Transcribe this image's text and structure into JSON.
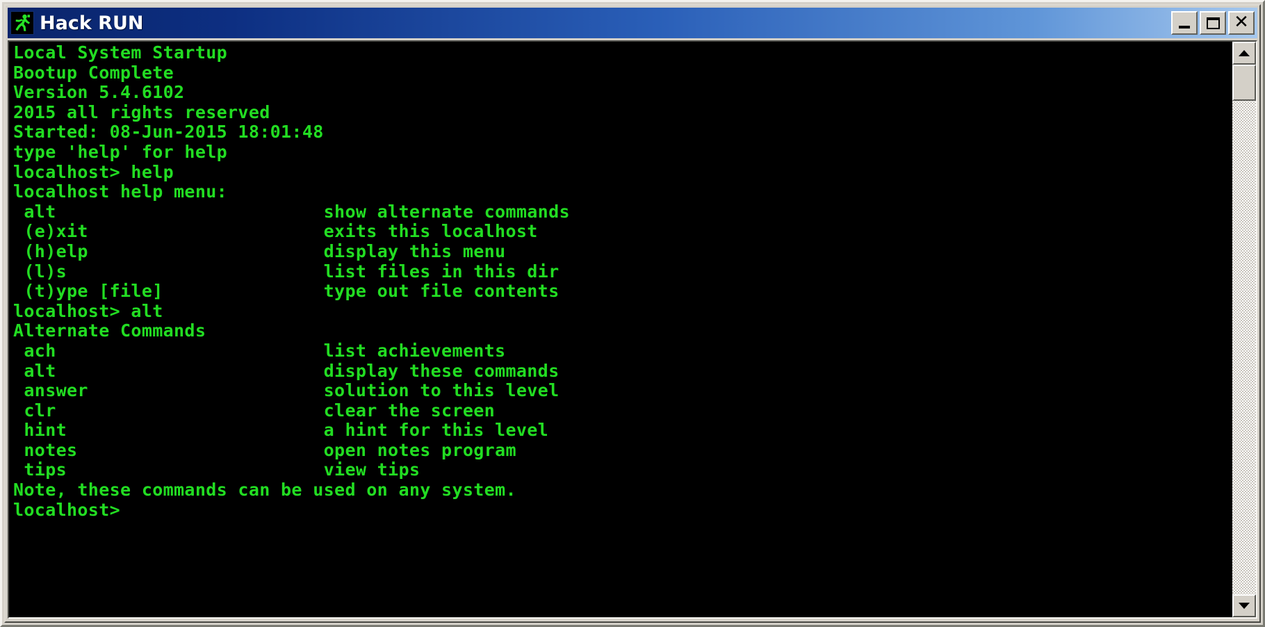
{
  "window": {
    "title": "Hack RUN",
    "icon": "running-man-icon",
    "buttons": {
      "minimize": "_",
      "maximize": "□",
      "close": "✕"
    },
    "accent_title_start": "#0a246a",
    "accent_title_end": "#a6c8ee",
    "chrome_color": "#d4d0c8"
  },
  "terminal": {
    "foreground": "#22dd22",
    "background": "#000000",
    "lines": [
      "Local System Startup",
      "Bootup Complete",
      "Version 5.4.6102",
      "2015 all rights reserved",
      "Started: 08-Jun-2015 18:01:48",
      "type 'help' for help",
      "localhost> help",
      "localhost help menu:",
      " alt                         show alternate commands",
      " (e)xit                      exits this localhost",
      " (h)elp                      display this menu",
      " (l)s                        list files in this dir",
      " (t)ype [file]               type out file contents",
      "localhost> alt",
      "Alternate Commands",
      " ach                         list achievements",
      " alt                         display these commands",
      " answer                      solution to this level",
      " clr                         clear the screen",
      " hint                        a hint for this level",
      " notes                       open notes program",
      " tips                        view tips",
      "Note, these commands can be used on any system.",
      "localhost>"
    ],
    "startup": {
      "title": "Local System Startup",
      "status": "Bootup Complete",
      "version": "Version 5.4.6102",
      "copyright": "2015 all rights reserved",
      "started": "Started: 08-Jun-2015 18:01:48",
      "help_hint": "type 'help' for help"
    },
    "prompt": "localhost>",
    "commands_entered": [
      "help",
      "alt"
    ],
    "help_menu": {
      "header": "localhost help menu:",
      "items": [
        {
          "command": "alt",
          "description": "show alternate commands"
        },
        {
          "command": "(e)xit",
          "description": "exits this localhost"
        },
        {
          "command": "(h)elp",
          "description": "display this menu"
        },
        {
          "command": "(l)s",
          "description": "list files in this dir"
        },
        {
          "command": "(t)ype [file]",
          "description": "type out file contents"
        }
      ]
    },
    "alternate_menu": {
      "header": "Alternate Commands",
      "items": [
        {
          "command": "ach",
          "description": "list achievements"
        },
        {
          "command": "alt",
          "description": "display these commands"
        },
        {
          "command": "answer",
          "description": "solution to this level"
        },
        {
          "command": "clr",
          "description": "clear the screen"
        },
        {
          "command": "hint",
          "description": "a hint for this level"
        },
        {
          "command": "notes",
          "description": "open notes program"
        },
        {
          "command": "tips",
          "description": "view tips"
        }
      ],
      "footer": "Note, these commands can be used on any system."
    }
  },
  "scrollbar": {
    "up_arrow": "▲",
    "down_arrow": "▼",
    "thumb_position_percent": 0
  }
}
